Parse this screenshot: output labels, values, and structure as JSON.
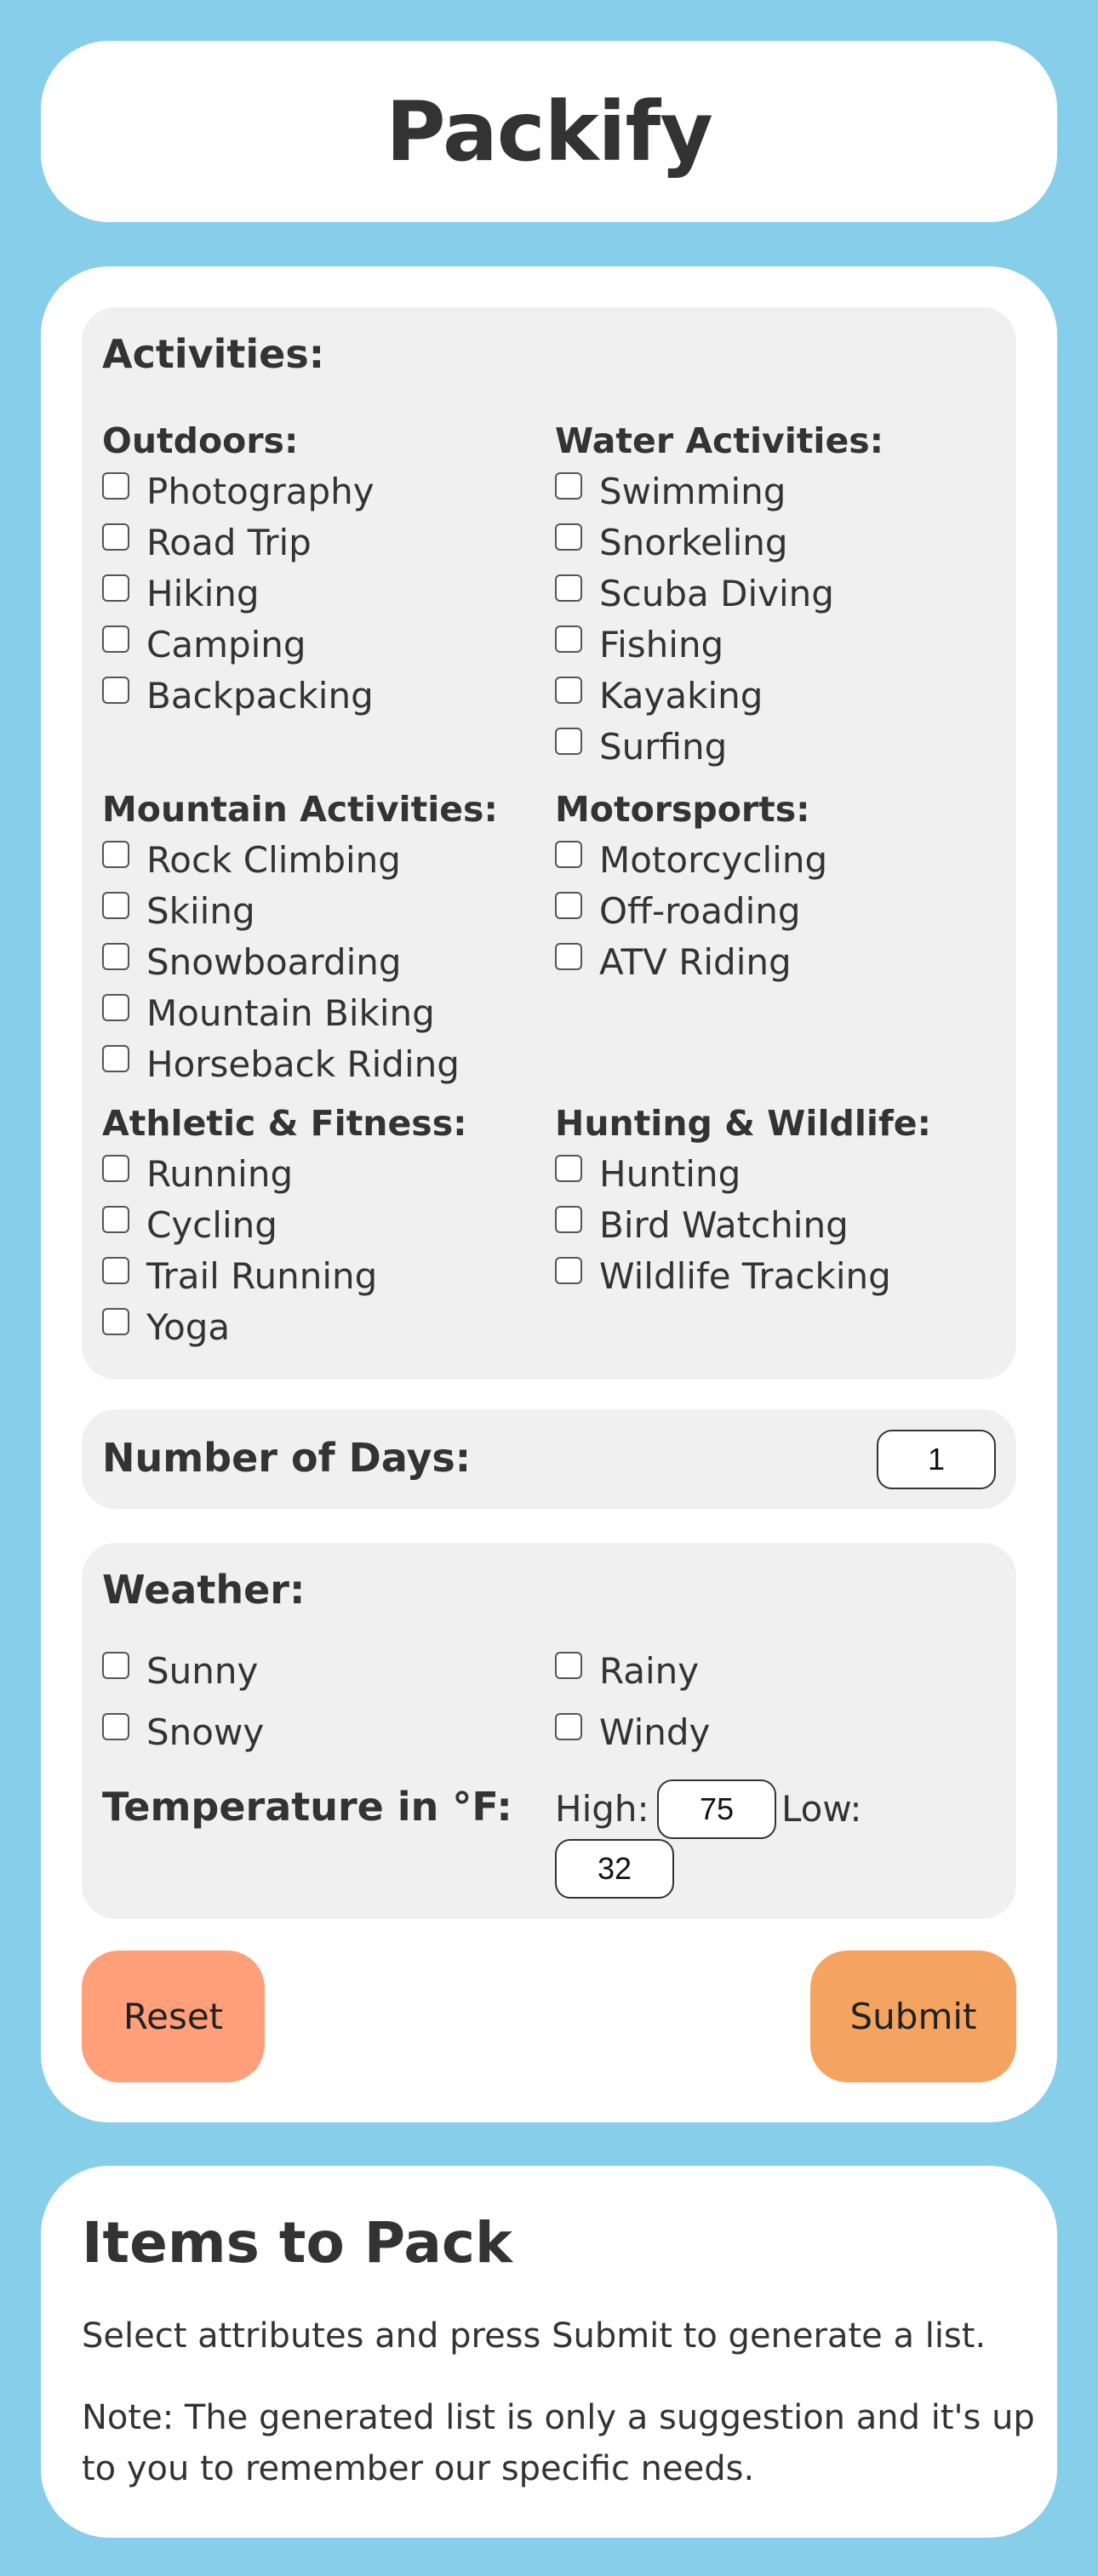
{
  "app": {
    "title": "Packify"
  },
  "activities": {
    "heading": "Activities:",
    "groups": [
      {
        "title": "Outdoors:",
        "options": [
          "Photography",
          "Road Trip",
          "Hiking",
          "Camping",
          "Backpacking"
        ]
      },
      {
        "title": "Water Activities:",
        "options": [
          "Swimming",
          "Snorkeling",
          "Scuba Diving",
          "Fishing",
          "Kayaking",
          "Surfing"
        ]
      },
      {
        "title": "Mountain Activities:",
        "options": [
          "Rock Climbing",
          "Skiing",
          "Snowboarding",
          "Mountain Biking",
          "Horseback Riding"
        ]
      },
      {
        "title": "Motorsports:",
        "options": [
          "Motorcycling",
          "Off-roading",
          "ATV Riding"
        ]
      },
      {
        "title": "Athletic & Fitness:",
        "options": [
          "Running",
          "Cycling",
          "Trail Running",
          "Yoga"
        ]
      },
      {
        "title": "Hunting & Wildlife:",
        "options": [
          "Hunting",
          "Bird Watching",
          "Wildlife Tracking"
        ]
      }
    ]
  },
  "days": {
    "label": "Number of Days:",
    "value": "1"
  },
  "weather": {
    "heading": "Weather:",
    "options": [
      "Sunny",
      "Rainy",
      "Snowy",
      "Windy"
    ],
    "temperature_label": "Temperature in °F:",
    "high_label": "High:",
    "high_value": "75",
    "low_label": "Low:",
    "low_value": "32"
  },
  "buttons": {
    "reset": "Reset",
    "submit": "Submit"
  },
  "results": {
    "title": "Items to Pack",
    "instruction": "Select attributes and press Submit to generate a list.",
    "note": "Note: The generated list is only a suggestion and it's up to you to remember our specific needs."
  }
}
